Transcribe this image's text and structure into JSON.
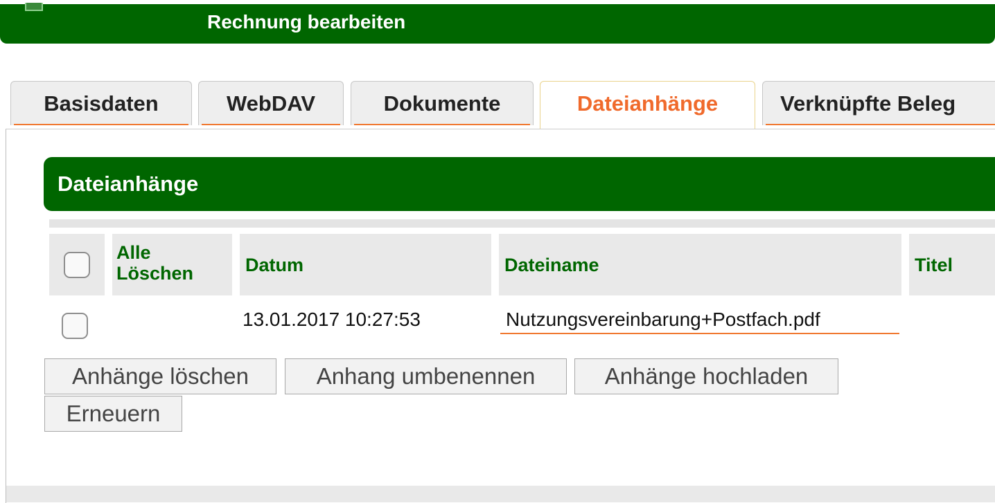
{
  "header": {
    "title": "Rechnung bearbeiten"
  },
  "tabs": [
    {
      "label": "Basisdaten",
      "active": false
    },
    {
      "label": "WebDAV",
      "active": false
    },
    {
      "label": "Dokumente",
      "active": false
    },
    {
      "label": "Dateianhänge",
      "active": true
    },
    {
      "label": "Verknüpfte Beleg",
      "active": false
    }
  ],
  "section": {
    "title": "Dateianhänge"
  },
  "table": {
    "headers": {
      "delete_all_line1": "Alle",
      "delete_all_line2": "Löschen",
      "date": "Datum",
      "filename": "Dateiname",
      "title": "Titel"
    },
    "rows": [
      {
        "checked": false,
        "date": "13.01.2017 10:27:53",
        "filename": "Nutzungsvereinbarung+Postfach.pdf",
        "title": ""
      }
    ]
  },
  "buttons": {
    "delete": "Anhänge löschen",
    "rename": "Anhang umbenennen",
    "upload": "Anhänge hochladen",
    "refresh": "Erneuern"
  },
  "colors": {
    "brand_green": "#006600",
    "accent_orange": "#f06a2c"
  }
}
